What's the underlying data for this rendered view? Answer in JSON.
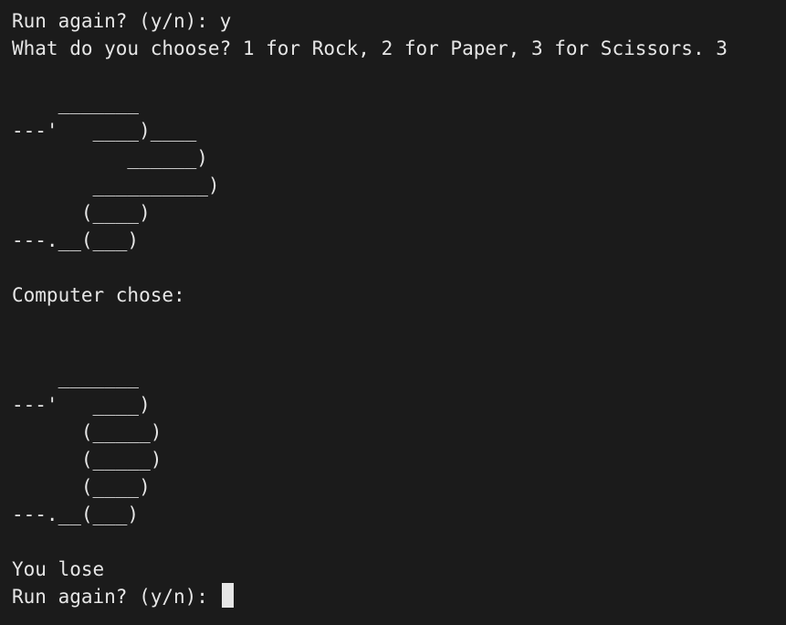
{
  "terminal": {
    "lines": [
      "Run again? (y/n): y",
      "What do you choose? 1 for Rock, 2 for Paper, 3 for Scissors. 3",
      "",
      "    _______",
      "---'   ____)____",
      "          ______)",
      "       __________)",
      "      (____)",
      "---.__(___)",
      "",
      "Computer chose:",
      "",
      "",
      "    _______",
      "---'   ____)",
      "      (_____)",
      "      (_____)",
      "      (____)",
      "---.__(___)",
      "",
      "You lose",
      "Run again? (y/n): "
    ]
  }
}
